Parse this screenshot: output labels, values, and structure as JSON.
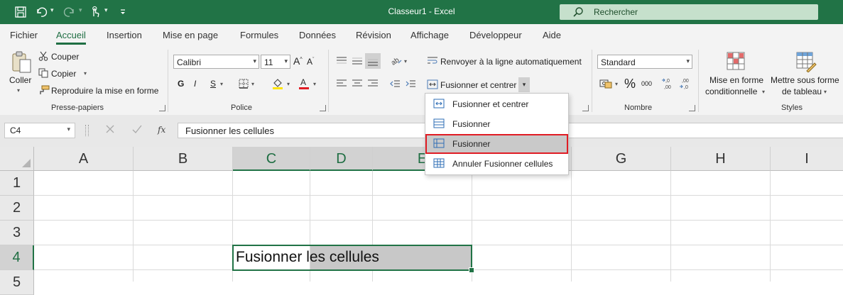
{
  "window": {
    "title": "Classeur1  -  Excel"
  },
  "search": {
    "label": "Rechercher"
  },
  "tabs": [
    "Fichier",
    "Accueil",
    "Insertion",
    "Mise en page",
    "Formules",
    "Données",
    "Révision",
    "Affichage",
    "Développeur",
    "Aide"
  ],
  "active_tab": "Accueil",
  "ribbon": {
    "clipboard": {
      "paste": "Coller",
      "cut": "Couper",
      "copy": "Copier",
      "format_painter": "Reproduire la mise en forme",
      "group": "Presse-papiers"
    },
    "font": {
      "name": "Calibri",
      "size": "11",
      "bold": "G",
      "italic": "I",
      "underline": "S",
      "group": "Police"
    },
    "alignment": {
      "wrap_text": "Renvoyer à la ligne automatiquement",
      "merge_center": "Fusionner et centrer"
    },
    "number": {
      "format": "Standard",
      "group": "Nombre"
    },
    "styles": {
      "conditional_line1": "Mise en forme",
      "conditional_line2": "conditionnelle",
      "table_line1": "Mettre sous forme",
      "table_line2": "de tableau",
      "group": "Styles"
    }
  },
  "formula_bar": {
    "name_box": "C4",
    "fx": "fx",
    "content": "Fusionner les cellules"
  },
  "grid": {
    "columns": [
      "A",
      "B",
      "C",
      "D",
      "E",
      "F",
      "G",
      "H",
      "I"
    ],
    "rows": [
      "1",
      "2",
      "3",
      "4",
      "5"
    ],
    "selected_column_headers": [
      "C",
      "D",
      "E"
    ],
    "selected_row_header": "4",
    "cell_c4": "Fusionner les cellules"
  },
  "merge_menu": {
    "items": [
      {
        "label": "Fusionner et centrer",
        "highlighted": false
      },
      {
        "label": "Fusionner",
        "highlighted": false
      },
      {
        "label": "Fusionner",
        "highlighted": true
      },
      {
        "label": "Annuler Fusionner cellules",
        "highlighted": false
      }
    ]
  },
  "colors": {
    "brand": "#217346",
    "highlight_border": "#e01c24",
    "selection_gray": "#c9c9c9"
  }
}
